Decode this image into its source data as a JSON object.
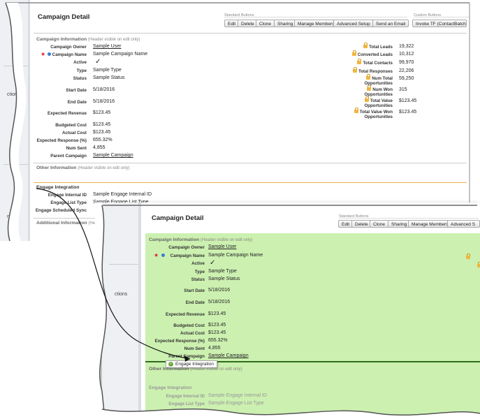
{
  "back": {
    "sidebar_fragments": [
      "ctions",
      "nt"
    ],
    "title": "Campaign Detail",
    "standard_buttons_label": "Standard Buttons",
    "custom_buttons_label": "Custom Buttons",
    "buttons": [
      "Edit",
      "Delete",
      "Clone",
      "Sharing",
      "Manage Members",
      "Advanced Setup",
      "Send an Email"
    ],
    "custom_button": "Invoke TF (ContactBatch",
    "info_section": "Campaign Information",
    "info_sub": "(Header visible on edit only)",
    "fields": [
      {
        "label": "Campaign Owner",
        "value": "Sample User",
        "link": true
      },
      {
        "label": "Campaign Name",
        "value": "Sample Campaign Name"
      },
      {
        "label": "Active",
        "value": "✓"
      },
      {
        "label": "Type",
        "value": "Sample Type"
      },
      {
        "label": "Status",
        "value": "Sample Status"
      },
      {
        "label": "Start Date",
        "value": "5/18/2016"
      },
      {
        "label": "End Date",
        "value": "5/18/2016"
      },
      {
        "label": "Expected Revenue",
        "value": "$123.45"
      },
      {
        "label": "Budgeted Cost",
        "value": "$123.45"
      },
      {
        "label": "Actual Cost",
        "value": "$123.45"
      },
      {
        "label": "Expected Response (%)",
        "value": "655.32%"
      },
      {
        "label": "Num Sent",
        "value": "4,855"
      },
      {
        "label": "Parent Campaign",
        "value": "Sample Campaign",
        "link": true
      }
    ],
    "stats": [
      {
        "label": "Total Leads",
        "value": "19,322"
      },
      {
        "label": "Converted Leads",
        "value": "10,312"
      },
      {
        "label": "Total Contacts",
        "value": "99,970"
      },
      {
        "label": "Total Responses",
        "value": "22,206"
      },
      {
        "label": "Num Total Opportunities",
        "value": "59,250"
      },
      {
        "label": "Num Won Opportunities",
        "value": "315"
      },
      {
        "label": "Total Value Opportunities",
        "value": "$123.45"
      },
      {
        "label": "Total Value Won Opportunities",
        "value": "$123.45"
      }
    ],
    "other_section": "Other Information",
    "other_sub": "(Header visible on edit only)",
    "engage_section": "Engage Integration",
    "engage_fields": [
      {
        "label": "Engage Internal ID",
        "value": "Sample Engage Internal ID"
      },
      {
        "label": "Engage List Type",
        "value": "Sample Engage List Type"
      },
      {
        "label": "Engage Scheduled Sync",
        "value": "✓"
      }
    ],
    "additional_section": "Additional Information",
    "additional_sub": "(Header visible on edit only)"
  },
  "front": {
    "sidebar_fragment": "ctions",
    "title": "Campaign Detail",
    "standard_buttons_label": "Standard Buttons",
    "buttons": [
      "Edit",
      "Delete",
      "Clone",
      "Sharing",
      "Manage Members",
      "Advanced S"
    ],
    "info_section": "Campaign Information",
    "info_sub": "(Header visible on edit only)",
    "fields": [
      {
        "label": "Campaign Owner",
        "value": "Sample User",
        "link": true
      },
      {
        "label": "Campaign Name",
        "value": "Sample Campaign Name"
      },
      {
        "label": "Active",
        "value": "✓"
      },
      {
        "label": "Type",
        "value": "Sample Type"
      },
      {
        "label": "Status",
        "value": "Sample Status"
      },
      {
        "label": "Start Date",
        "value": "5/18/2016"
      },
      {
        "label": "End Date",
        "value": "5/18/2016"
      },
      {
        "label": "Expected Revenue",
        "value": "$123.45"
      },
      {
        "label": "Budgeted Cost",
        "value": "$123.45"
      },
      {
        "label": "Actual Cost",
        "value": "$123.45"
      },
      {
        "label": "Expected Response (%)",
        "value": "655.32%"
      },
      {
        "label": "Num Sent",
        "value": "4,855"
      },
      {
        "label": "Parent Campaign",
        "value": "Sample Campaign",
        "link": true
      }
    ],
    "tooltip": "Engage Integration",
    "other_section": "Other Information",
    "other_sub": "(Header visible on edit only)",
    "engage_section": "Engage Integration",
    "engage_fields": [
      {
        "label": "Engage Internal ID",
        "value": "Sample Engage Internal ID"
      },
      {
        "label": "Engage List Type",
        "value": "Sample Engage List Type"
      }
    ]
  },
  "colors": {
    "highlight": "#ccf0b0",
    "required": "#d8262c",
    "info_dot": "#3a7fd5",
    "lock": "#f1b640",
    "drop_line": "#2f6e1a",
    "engage_rule": "#e8b04a"
  }
}
